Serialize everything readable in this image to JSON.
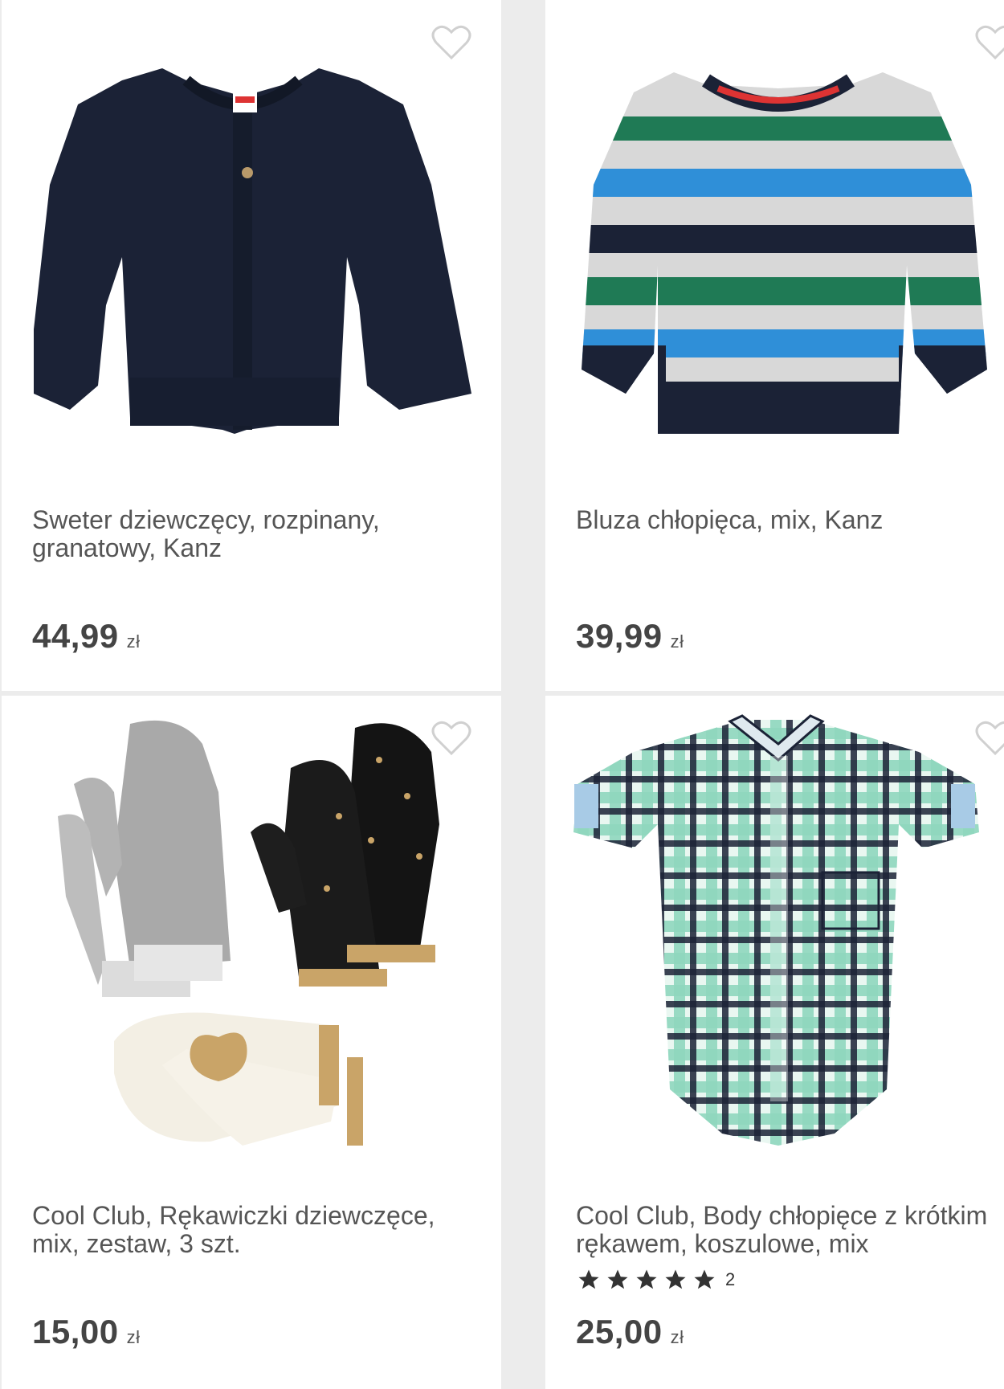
{
  "products": [
    {
      "title": "Sweter dziewczęcy, rozpinany,\ngranatowy, Kanz",
      "price": "44,99",
      "currency": "zł",
      "image_icon": "cardigan-image"
    },
    {
      "title": "Bluza chłopięca, mix, Kanz",
      "price": "39,99",
      "currency": "zł",
      "image_icon": "striped-sweatshirt-image"
    },
    {
      "title": "Cool Club, Rękawiczki dziewczęce,\nmix, zestaw, 3 szt.",
      "price": "15,00",
      "currency": "zł",
      "image_icon": "mittens-image"
    },
    {
      "title_line1": "Cool Club, Body chłopięce z krótkim",
      "title_line2": "rękawem, koszulowe, mix",
      "price": "25,00",
      "currency": "zł",
      "rating": 5,
      "rating_count": "2",
      "image_icon": "plaid-bodysuit-image"
    }
  ],
  "colors": {
    "navy": "#1b2236",
    "blue": "#2f8fd8",
    "green": "#1f7a55",
    "grey": "#d6d6d6",
    "mint": "#8fd8be"
  }
}
